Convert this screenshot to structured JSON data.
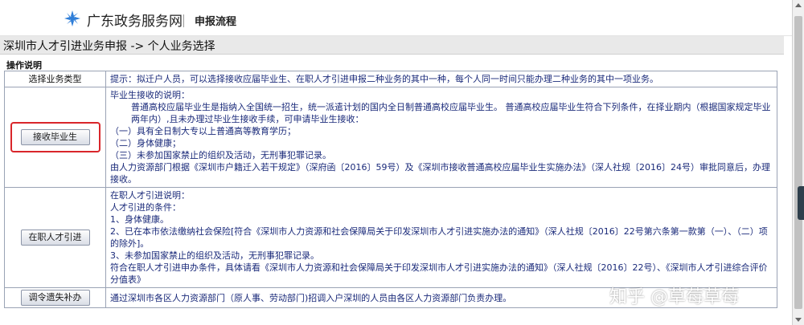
{
  "header": {
    "logo_text": "广东政务服务网",
    "flow_title": "申报流程"
  },
  "breadcrumb": "深圳市人才引进业务申报 -> 个人业务选择",
  "section_title": "操作说明",
  "table": {
    "row0": {
      "left": "选择业务类型",
      "right": "提示：拟迁户人员，可以选择接收应届毕业生、在职人才引进申报二种业务的其中一种，每个人同一时间只能办理二种业务的其中一项业务。"
    },
    "row1": {
      "button": "接收毕业生",
      "lines": [
        "毕业生接收的说明：",
        "普通高校应届毕业生是指纳入全国统一招生，统一派遣计划的国内全日制普通高校应届毕业生。 普通高校应届毕业生符合下列条件，在择业期内（根据国家规定毕业两年内）,且未办理过毕业生接收手续，可申请毕业生接收：",
        "（一）具有全日制大专以上普通高等教育学历；",
        "（二）身体健康；",
        "（三）未参加国家禁止的组织及活动，无刑事犯罪记录。",
        "由人力资源部门根据《深圳市户籍迁入若干规定》（深府函〔2016〕59号）及《深圳市接收普通高校应届毕业生实施办法》（深人社规〔2016〕24号）审批同意后，办理接收。"
      ]
    },
    "row2": {
      "button": "在职人才引进",
      "lines": [
        "在职人才引进说明：",
        "人才引进的条件：",
        "1、身体健康。",
        "2、已在本市依法缴纳社会保险[符合《深圳市人力资源和社会保障局关于印发深圳市人才引进实施办法的通知》（深人社规〔2016〕22号第六条第一款第（一）、（二）项的除外]。",
        "3、未参加国家禁止的组织及活动，无刑事犯罪记录。",
        "符合在职人才引进申办条件，具体请看《深圳市人力资源和社会保障局关于印发深圳市人才引进实施办法的通知》（深人社规〔2016〕22号）、《深圳市人才引进综合评价分值表》"
      ]
    },
    "row3": {
      "button": "调令遗失补办",
      "right": "通过深圳市各区人力资源部门（原人事、劳动部门)招调入户深圳的人员由各区人力资源部门负责办理。"
    }
  },
  "watermark": "知乎 @草莓草莓",
  "colors": {
    "highlight": "#d9262b",
    "logo": "#2f7ed8",
    "body_text": "#1a2a7a"
  }
}
